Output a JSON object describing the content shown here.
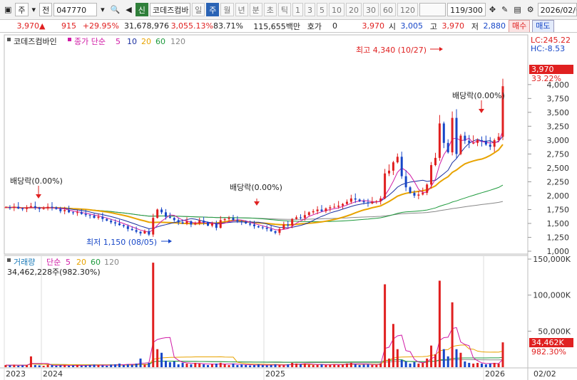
{
  "toolbar": {
    "type_label": "주",
    "prev_label": "전",
    "code": "047770",
    "sin_label": "신",
    "name": "코데즈컴바",
    "periods": [
      "일",
      "주",
      "월",
      "년",
      "분",
      "초",
      "틱"
    ],
    "active_period": "주",
    "nums": [
      "1",
      "3",
      "5",
      "10",
      "20",
      "30",
      "60",
      "120"
    ],
    "counter": "119/300",
    "date": "2026/02/0"
  },
  "quote": {
    "price": "3,970",
    "change": "915",
    "pct": "+29.95%",
    "volume": "31,678,976",
    "vol_rate": "3,055.13%",
    "turnover_rate": "83.71%",
    "amount": "115,655백만",
    "hoga_label": "호가",
    "hoga_value": "0",
    "bid": "3,970",
    "open_label": "시",
    "open": "3,005",
    "high_label": "고",
    "high": "3,970",
    "low_label": "저",
    "low": "2,880",
    "buy_label": "매수",
    "sell_label": "매도"
  },
  "price_panel": {
    "title": "코데즈컴바인",
    "ma_label": "종가 단순",
    "ma_periods": [
      "5",
      "10",
      "20",
      "60",
      "120"
    ],
    "lc": "LC:245.22",
    "hc": "HC:-8.53",
    "current_tag": "3,970",
    "current_pct": "33.22%",
    "annotations": {
      "high": "최고 4,340 (10/27)",
      "low": "최저 1,150 (08/05)",
      "div1": "배당락(0.00%)",
      "div2": "배당락(0.00%)",
      "div3": "배당락(0.00%)"
    }
  },
  "volume_panel": {
    "title": "거래량",
    "ma_label": "단순",
    "ma_periods": [
      "5",
      "20",
      "60",
      "120"
    ],
    "current": "34,462,228주(982.30%)",
    "tag_value": "34,462K",
    "tag_pct": "982.30%"
  },
  "colors": {
    "up": "#e02020",
    "down": "#1747c8",
    "ma5": "#d01aa5",
    "ma10": "#1a2fa0",
    "ma20": "#e8a300",
    "ma60": "#1d9a3c",
    "ma120": "#888888"
  },
  "chart_data": {
    "type": "line",
    "x_labels": [
      "2023",
      "2024",
      "2025",
      "2026",
      "02/02"
    ],
    "price_ylim": [
      1000,
      4600
    ],
    "price_ticks": [
      "4,000",
      "3,750",
      "3,500",
      "3,250",
      "3,000",
      "2,750",
      "2,500",
      "2,250",
      "2,000",
      "1,750",
      "1,500",
      "1,250",
      "1,000"
    ],
    "volume_ylim": [
      0,
      155000
    ],
    "volume_ticks": [
      "150,000K",
      "100,000K",
      "50,000K"
    ],
    "weeks": 119,
    "close": [
      1790,
      1780,
      1800,
      1770,
      1760,
      1790,
      1810,
      1780,
      1760,
      1770,
      1800,
      1790,
      1760,
      1720,
      1740,
      1700,
      1690,
      1700,
      1670,
      1650,
      1640,
      1600,
      1620,
      1580,
      1550,
      1520,
      1500,
      1470,
      1450,
      1400,
      1380,
      1350,
      1320,
      1360,
      1300,
      1600,
      1750,
      1700,
      1620,
      1600,
      1560,
      1520,
      1500,
      1540,
      1480,
      1500,
      1550,
      1520,
      1460,
      1500,
      1420,
      1560,
      1580,
      1600,
      1560,
      1540,
      1520,
      1500,
      1480,
      1450,
      1430,
      1420,
      1400,
      1360,
      1330,
      1400,
      1480,
      1460,
      1580,
      1610,
      1600,
      1650,
      1700,
      1720,
      1750,
      1720,
      1770,
      1790,
      1800,
      1820,
      1850,
      1890,
      1950,
      1930,
      1900,
      1880,
      1860,
      1890,
      1900,
      1950,
      2400,
      2450,
      2600,
      2700,
      2350,
      2150,
      2050,
      2000,
      2020,
      2050,
      2200,
      2550,
      2680,
      3300,
      2950,
      2780,
      3400,
      2750,
      3080,
      2990,
      2950,
      2950,
      3000,
      2980,
      2920,
      2880,
      3000,
      3060,
      3970
    ],
    "volume_k": [
      3000,
      2500,
      3500,
      2000,
      2500,
      3000,
      15000,
      3000,
      2500,
      2000,
      3500,
      3000,
      2000,
      2500,
      3000,
      2000,
      2500,
      3000,
      2000,
      2500,
      3000,
      3500,
      3000,
      2500,
      2000,
      3500,
      4000,
      5000,
      3000,
      4000,
      3500,
      5000,
      12000,
      4000,
      6000,
      145000,
      25000,
      20000,
      9000,
      7000,
      8000,
      4000,
      6000,
      5000,
      4000,
      6000,
      5000,
      4000,
      3000,
      4000,
      5000,
      6000,
      4000,
      3000,
      5000,
      3000,
      4000,
      3000,
      2500,
      3000,
      4000,
      3000,
      2500,
      3000,
      4000,
      3000,
      2500,
      4000,
      6000,
      5000,
      4000,
      5000,
      3500,
      3000,
      3500,
      4000,
      3000,
      3500,
      4000,
      3000,
      4000,
      5000,
      6000,
      4000,
      3000,
      3500,
      4000,
      3000,
      3500,
      5000,
      115000,
      12000,
      60000,
      25000,
      10000,
      8000,
      5000,
      7000,
      5000,
      6000,
      12000,
      30000,
      18000,
      120000,
      25000,
      15000,
      90000,
      25000,
      20000,
      8000,
      6000,
      5000,
      6000,
      5000,
      4000,
      5000,
      6000,
      5000,
      34462
    ]
  }
}
